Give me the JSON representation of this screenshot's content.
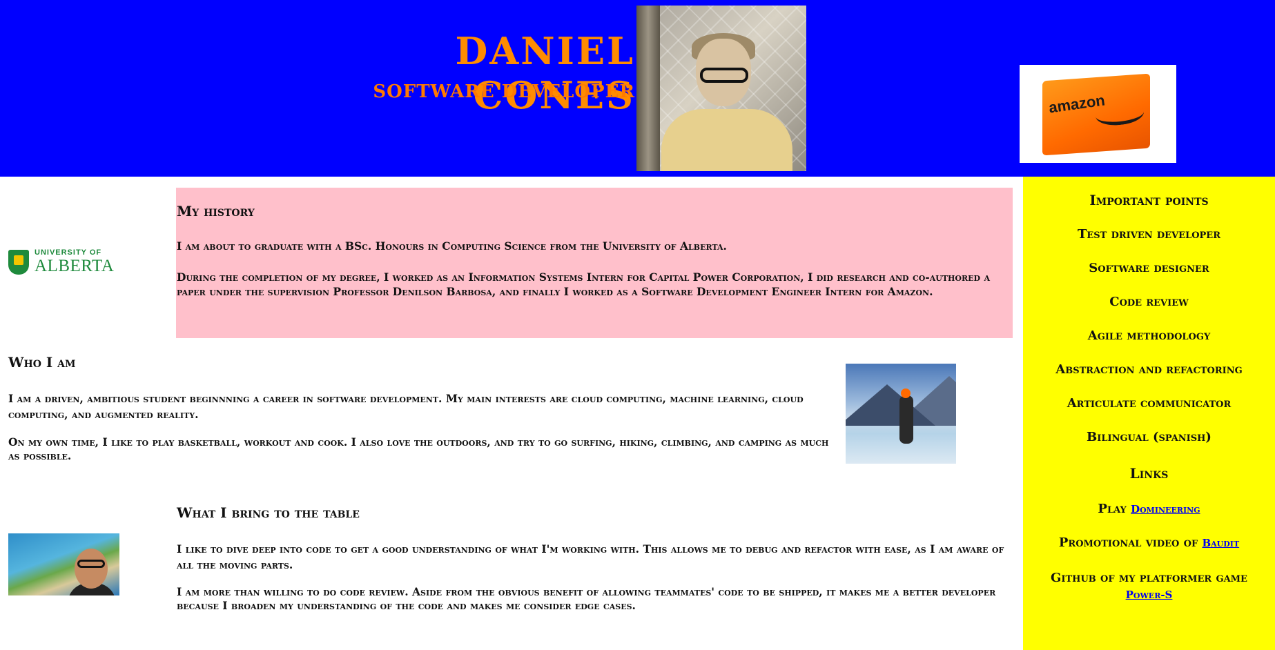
{
  "header": {
    "name": "Daniel Cones",
    "role": "Software Developer",
    "bg_color": "#0000ff",
    "name_color": "#ff8c00"
  },
  "history": {
    "heading": "My history",
    "p1": "I am about to graduate with a BSc. Honours in Computing Science from the University of Alberta.",
    "p2": "During the completion of my degree, I worked as an Information Systems Intern for Capital Power Corporation, I did research and co-authored a paper under the supervision Professor Denilson Barbosa, and finally I worked as a Software Development Engineer Intern for Amazon.",
    "bg_color": "#ffc0cb"
  },
  "ua_logo": {
    "line1": "UNIVERSITY OF",
    "line2": "ALBERTA"
  },
  "who": {
    "heading": "Who I am",
    "p1": "I am a driven, ambitious student beginnning a career in software development. My main interests are cloud computing, machine learning, cloud computing, and augmented reality.",
    "p2": "On my own time, I like to play basketball, workout and cook. I also love the outdoors, and try to go surfing, hiking, climbing, and camping as much as possible."
  },
  "bring": {
    "heading": "What I bring to the table",
    "p1": "I like to dive deep into code to get a good understanding of what I'm working with. This allows me to debug and refactor with ease, as I am aware of all the moving parts.",
    "p2": "I am more than willing to do code review. Aside from the obvious benefit of allowing teammates' code to be shipped, it makes me a better developer because I broaden my understanding of the code and makes me consider edge cases."
  },
  "sidebar": {
    "bg_color": "#ffff00",
    "title": "Important points",
    "points": [
      "Test driven developer",
      "Software designer",
      "Code review",
      "Agile methodology",
      "Abstraction and refactoring",
      "Articulate communicator",
      "Bilingual (spanish)"
    ],
    "links_title": "Links",
    "link1_prefix": "Play ",
    "link1_text": "Domineering",
    "link2_prefix": "Promotional video of ",
    "link2_text": "Baudit",
    "link3_prefix": "Github of my platformer game",
    "link3_text": "Power-S"
  },
  "images": {
    "amazon_word": "amazon"
  }
}
